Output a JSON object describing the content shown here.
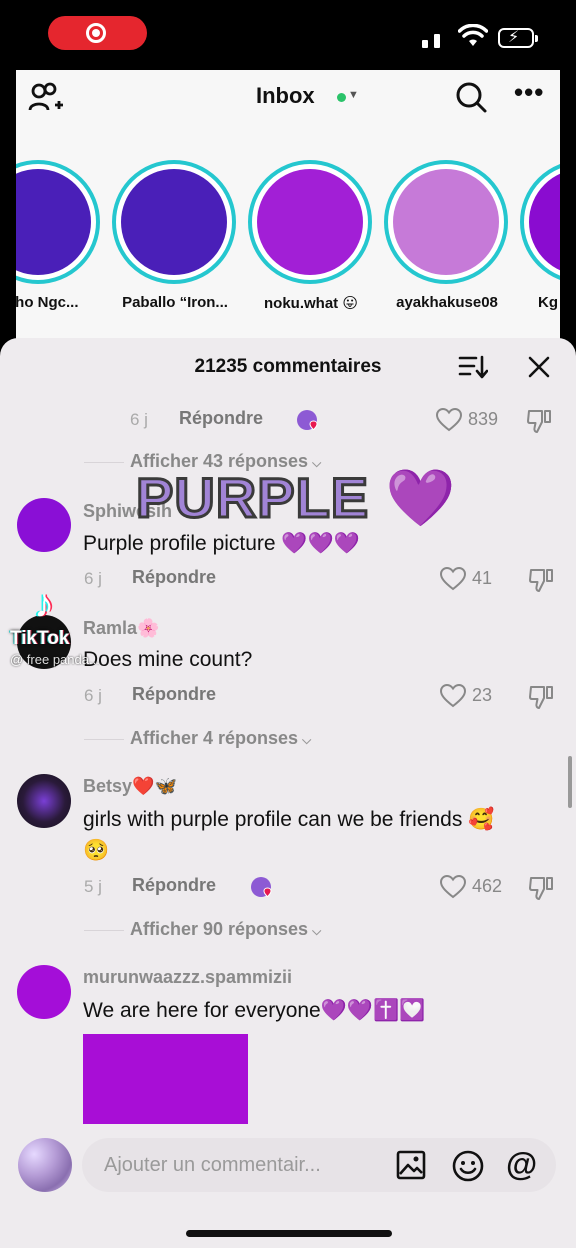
{
  "status_bar": {
    "icons": [
      "recording-icon",
      "signal-icon",
      "wifi-icon",
      "battery-charging-icon"
    ]
  },
  "inbox": {
    "title": "Inbox",
    "icons": [
      "add-friend-icon",
      "search-icon",
      "more-icon"
    ],
    "stories": [
      {
        "name": "pho Ngc...",
        "color": "#4a1fb8"
      },
      {
        "name": "Paballo “Iron...",
        "color": "#4a1fb8"
      },
      {
        "name": "noku.what 😛",
        "color": "#a21fd6"
      },
      {
        "name": "ayakhakuse08",
        "color": "#c67ad8"
      },
      {
        "name": "Kg",
        "color": "#8a0cd0"
      }
    ]
  },
  "sheet": {
    "comments_count": "21235 commentaires",
    "icons": [
      "sort-icon",
      "close-icon"
    ]
  },
  "comments": [
    {
      "id": "c0",
      "time": "6 j",
      "reply_label": "Répondre",
      "likes": "839",
      "has_creator_badge": true,
      "show_replies": "Afficher 43 réponses"
    },
    {
      "id": "c1",
      "username": "Sphiwesih",
      "avatar_color": "#8a0fd6",
      "text": "Purple profile picture 💜💜💜",
      "time": "6 j",
      "reply_label": "Répondre",
      "likes": "41"
    },
    {
      "id": "c2",
      "username": "Ramla🌸",
      "avatar_color": "#111111",
      "text": "Does mine count?",
      "time": "6 j",
      "reply_label": "Répondre",
      "likes": "23",
      "show_replies": "Afficher 4 réponses"
    },
    {
      "id": "c3",
      "username": "Betsy❤️🦋",
      "avatar_color": "#1a1224",
      "text_line1": "girls with purple profile can we be friends 🥰",
      "text_line2": "🥺",
      "time": "5 j",
      "reply_label": "Répondre",
      "likes": "462",
      "has_creator_badge": true,
      "show_replies": "Afficher 90 réponses"
    },
    {
      "id": "c4",
      "username": "murunwaazzz.spammizii",
      "avatar_color": "#a40ed8",
      "text": "We are here for everyone💜💜✝️💟",
      "image_color": "#a80ed6"
    }
  ],
  "input": {
    "placeholder": "Ajouter un commentair...",
    "icons": [
      "image-icon",
      "emoji-icon",
      "mention-icon"
    ],
    "mention_symbol": "@"
  },
  "overlay": {
    "caption": "PURPLE 💜",
    "watermark_brand": "TikTok",
    "watermark_handle": "@ free panda..."
  },
  "colors": {
    "accent_red": "#e5262e",
    "story_ring": "#25c7cf",
    "online": "#2bc36a",
    "sheet_bg": "#eeebee"
  }
}
